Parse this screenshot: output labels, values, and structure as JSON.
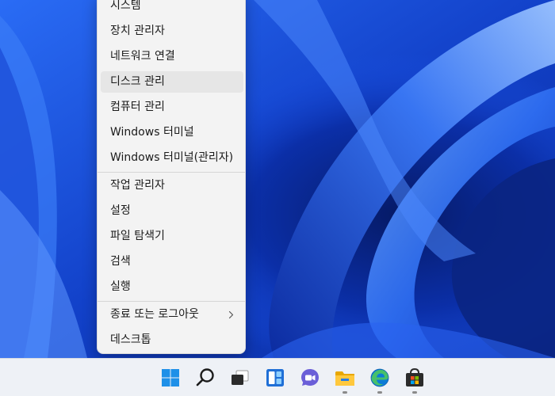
{
  "menu": {
    "items": [
      {
        "label": "시스템"
      },
      {
        "label": "장치 관리자"
      },
      {
        "label": "네트워크 연결"
      },
      {
        "label": "디스크 관리"
      },
      {
        "label": "컴퓨터 관리"
      },
      {
        "label": "Windows 터미널"
      },
      {
        "label": "Windows 터미널(관리자)"
      },
      {
        "label": "작업 관리자"
      },
      {
        "label": "설정"
      },
      {
        "label": "파일 탐색기"
      },
      {
        "label": "검색"
      },
      {
        "label": "실행"
      },
      {
        "label": "종료 또는 로그아웃",
        "has_submenu": true,
        "icon": "chevron-right-icon"
      },
      {
        "label": "데스크톱"
      }
    ],
    "hovered_item": "디스크 관리"
  },
  "taskbar": {
    "icons": [
      {
        "name": "start-icon",
        "running": false
      },
      {
        "name": "search-icon",
        "running": false
      },
      {
        "name": "task-view-icon",
        "running": false
      },
      {
        "name": "widgets-icon",
        "running": false
      },
      {
        "name": "chat-icon",
        "running": false
      },
      {
        "name": "file-explorer-icon",
        "running": true
      },
      {
        "name": "edge-icon",
        "running": true
      },
      {
        "name": "store-icon",
        "running": true
      }
    ]
  },
  "colors": {
    "wallpaper": "#1a52e8",
    "menu_bg": "#f3f3f3",
    "hover_bg": "#e6e6e6",
    "taskbar_bg": "#eef1f6",
    "accent": "#0078d4"
  }
}
